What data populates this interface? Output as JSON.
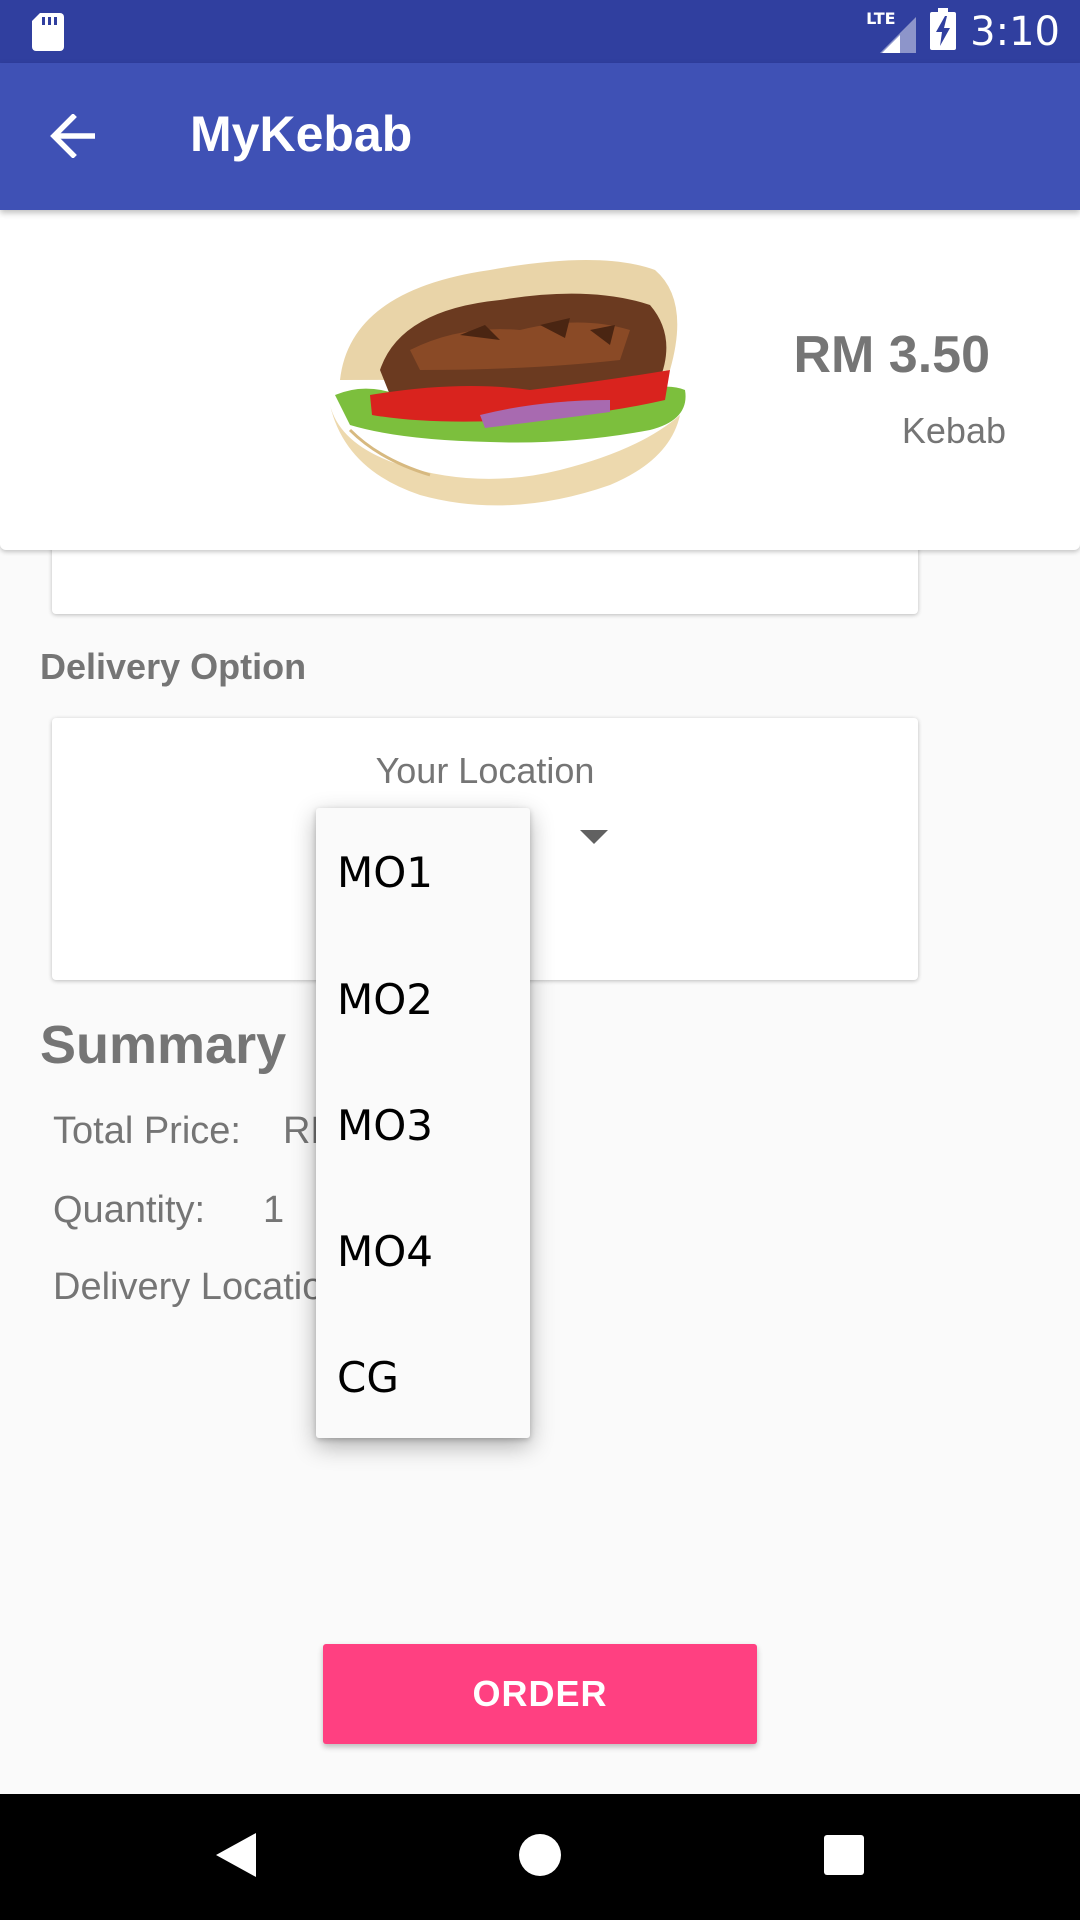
{
  "status_bar": {
    "time": "3:10",
    "network": "LTE",
    "icons": [
      "sd-card-icon",
      "signal-icon",
      "battery-charging-icon"
    ]
  },
  "app_bar": {
    "title": "MyKebab",
    "back_icon": "arrow-back-icon"
  },
  "product": {
    "price": "RM 3.50",
    "name": "Kebab",
    "image": "kebab-image"
  },
  "delivery": {
    "section_label": "Delivery Option",
    "location_label": "Your Location",
    "dropdown_options": [
      "MO1",
      "MO2",
      "MO3",
      "MO4",
      "CG"
    ]
  },
  "summary": {
    "title": "Summary",
    "total_price_label": "Total Price:",
    "total_price_value_visible": "RM",
    "quantity_label": "Quantity:",
    "quantity_value": "1",
    "delivery_location_label": "Delivery Location"
  },
  "order_button": {
    "label": "ORDER"
  },
  "colors": {
    "status_bar": "#303f9f",
    "app_bar": "#3f51b5",
    "accent": "#ff4081",
    "text_secondary": "#757575"
  }
}
